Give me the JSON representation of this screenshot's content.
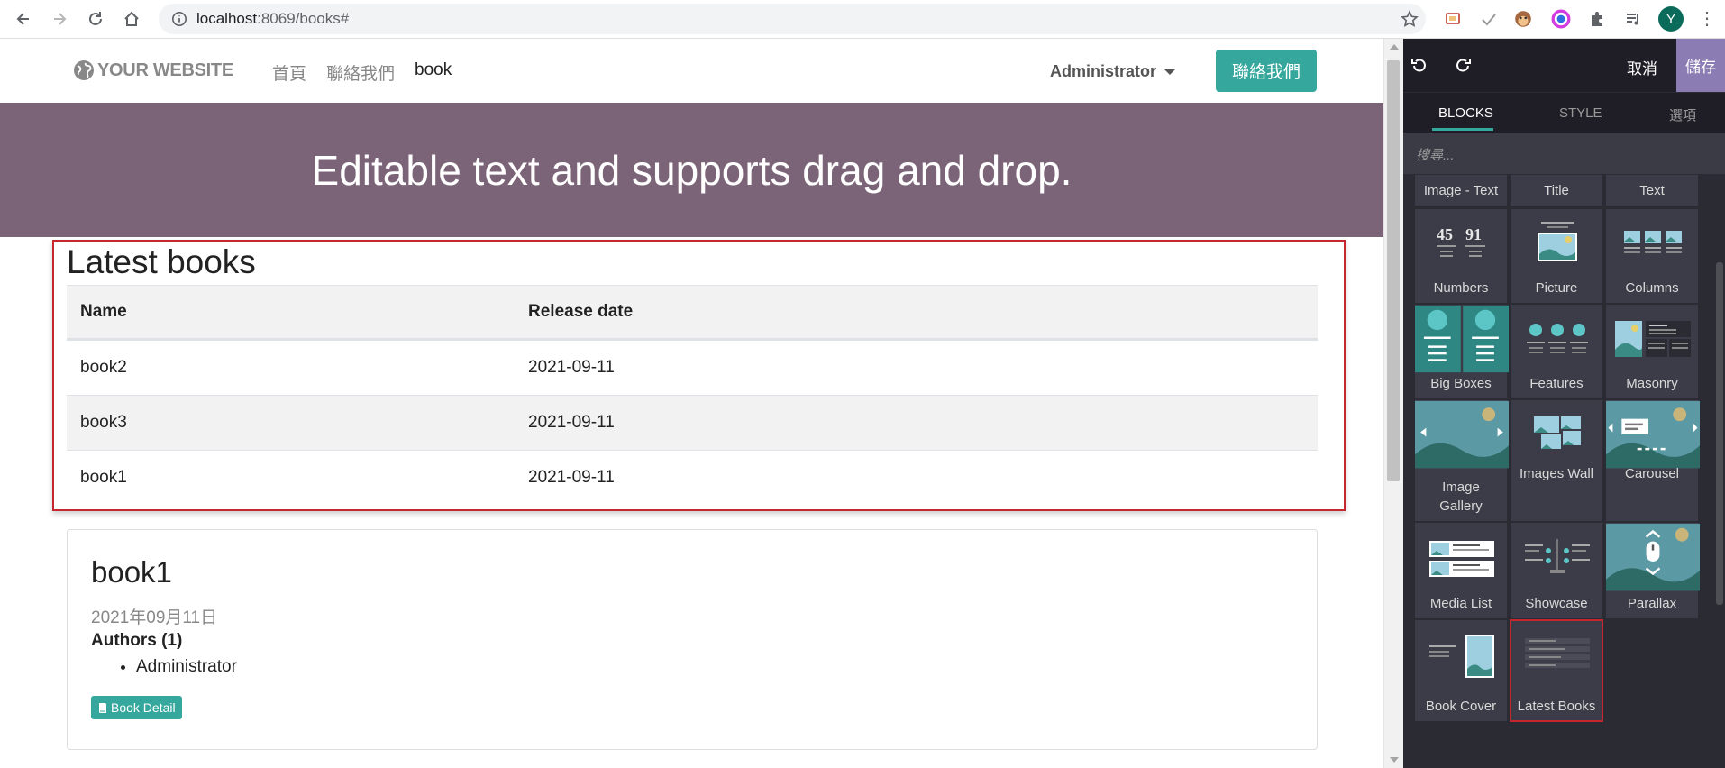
{
  "browser": {
    "url_host": "localhost",
    "url_rest": ":8069/books#",
    "avatar_letter": "Y"
  },
  "site": {
    "logo": "YOUR WEBSITE",
    "menu": [
      "首頁",
      "聯絡我們",
      "book"
    ],
    "user": "Administrator",
    "cta": "聯絡我們",
    "banner": "Editable text and supports drag and drop."
  },
  "latest": {
    "title": "Latest books",
    "columns": [
      "Name",
      "Release date"
    ],
    "rows": [
      {
        "name": "book2",
        "date": "2021-09-11"
      },
      {
        "name": "book3",
        "date": "2021-09-11"
      },
      {
        "name": "book1",
        "date": "2021-09-11"
      }
    ]
  },
  "book": {
    "title": "book1",
    "date": "2021年09月11日",
    "authors_label": "Authors (1)",
    "author": "Administrator",
    "detail_button": "Book Detail"
  },
  "panel": {
    "cancel": "取消",
    "save": "儲存",
    "tabs": [
      "BLOCKS",
      "STYLE",
      "選項"
    ],
    "search_placeholder": "搜尋...",
    "top_labels": [
      "Image - Text",
      "Title",
      "Text"
    ],
    "tiles": [
      {
        "label": "Numbers",
        "icon": "numbers-icon"
      },
      {
        "label": "Picture",
        "icon": "picture-icon"
      },
      {
        "label": "Columns",
        "icon": "columns-icon"
      },
      {
        "label": "Big Boxes",
        "icon": "big-boxes-icon"
      },
      {
        "label": "Features",
        "icon": "features-icon"
      },
      {
        "label": "Masonry",
        "icon": "masonry-icon"
      },
      {
        "label": "Image Gallery",
        "icon": "image-gallery-icon"
      },
      {
        "label": "Images Wall",
        "icon": "images-wall-icon"
      },
      {
        "label": "Carousel",
        "icon": "carousel-icon"
      },
      {
        "label": "Media List",
        "icon": "media-list-icon"
      },
      {
        "label": "Showcase",
        "icon": "showcase-icon"
      },
      {
        "label": "Parallax",
        "icon": "parallax-icon"
      },
      {
        "label": "Book Cover",
        "icon": "book-cover-icon"
      },
      {
        "label": "Latest Books",
        "icon": "latest-books-icon"
      }
    ],
    "numbers_digits": [
      "45",
      "91"
    ]
  },
  "colors": {
    "accent": "#35a79c",
    "banner": "#7c6478",
    "highlight": "#c6262d",
    "save": "#8b7cb4"
  }
}
